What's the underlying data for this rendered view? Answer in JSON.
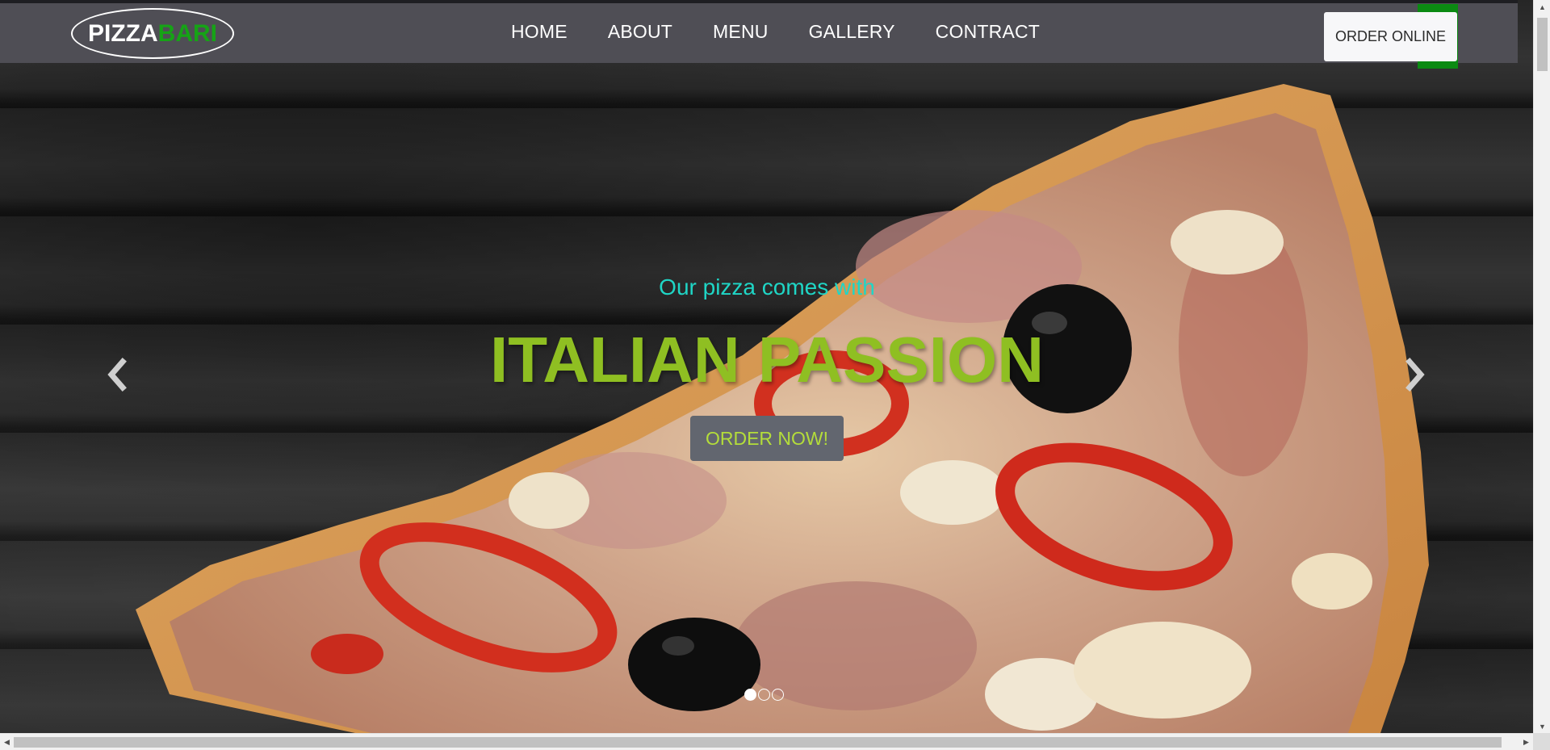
{
  "logo": {
    "part1": "PIZZA",
    "part2": "BARI"
  },
  "nav": {
    "links": [
      "HOME",
      "ABOUT",
      "MENU",
      "GALLERY",
      "CONTRACT"
    ],
    "order_online": "ORDER ONLINE"
  },
  "hero": {
    "tagline": "Our pizza comes with",
    "headline": "ITALIAN PASSION",
    "cta": "ORDER NOW!",
    "slides_total": 3,
    "active_slide": 1
  },
  "icons": {
    "prev": "chevron-left-icon",
    "next": "chevron-right-icon"
  },
  "colors": {
    "navbar": "#4f4e55",
    "logo_accent": "#16a316",
    "tagline": "#1fd6c6",
    "headline": "#8fbf22",
    "cta_bg": "#62666f",
    "cta_text": "#b4dd3a",
    "order_online_accent": "#0b8a12"
  }
}
